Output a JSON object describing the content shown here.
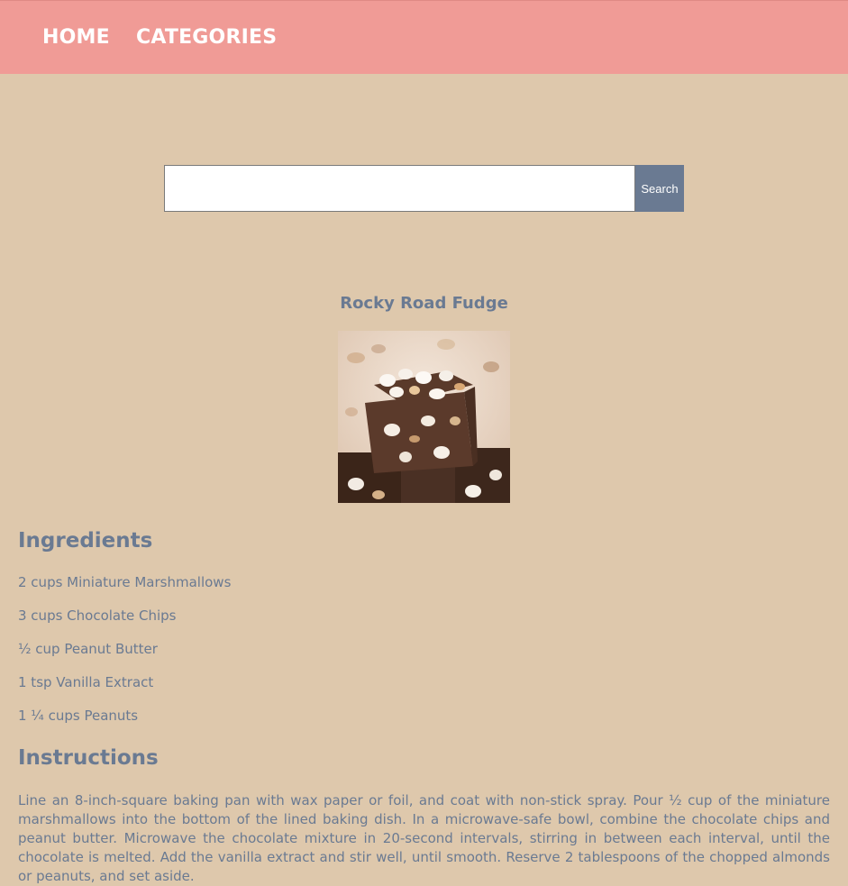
{
  "nav": {
    "home_label": "HOME",
    "categories_label": "CATEGORIES"
  },
  "search": {
    "value": "",
    "button_label": "Search"
  },
  "recipe": {
    "title": "Rocky Road Fudge",
    "ingredients_heading": "Ingredients",
    "ingredients": [
      "2 cups Miniature Marshmallows",
      "3 cups Chocolate Chips",
      "½ cup Peanut Butter",
      "1 tsp Vanilla Extract",
      "1 ¼ cups Peanuts"
    ],
    "instructions_heading": "Instructions",
    "instructions": "Line an 8-inch-square baking pan with wax paper or foil, and coat with non-stick spray. Pour ½ cup of the miniature marshmallows into the bottom of the lined baking dish. In a microwave-safe bowl, combine the chocolate chips and peanut butter. Microwave the chocolate mixture in 20-second intervals, stirring in between each interval, until the chocolate is melted. Add the vanilla extract and stir well, until smooth. Reserve 2 tablespoons of the chopped almonds or peanuts, and set aside."
  },
  "colors": {
    "navbar": "#f09b96",
    "page_background": "#dec8ac",
    "accent_text": "#6a7a92",
    "search_button": "#6a7a92"
  }
}
